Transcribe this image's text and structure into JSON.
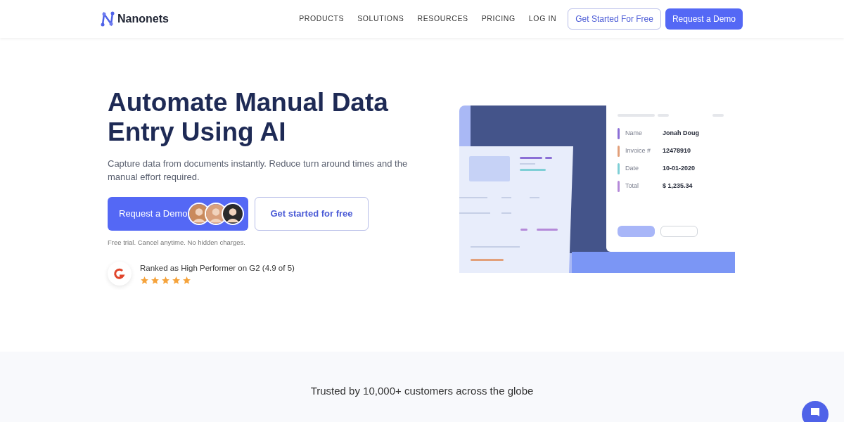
{
  "nav": {
    "brand": "Nanonets",
    "links": [
      "PRODUCTS",
      "SOLUTIONS",
      "RESOURCES",
      "PRICING",
      "LOG IN"
    ],
    "secondary_button": "Get Started For Free",
    "primary_button": "Request a Demo"
  },
  "hero": {
    "title": "Automate Manual Data Entry Using AI",
    "subtitle": "Capture data from documents instantly. Reduce turn around times and the manual effort required.",
    "demo_button": "Request a Demo",
    "free_button": "Get started for free",
    "note": "Free trial. Cancel anytime. No hidden charges.",
    "rating": {
      "text": "Ranked as High Performer on G2 (4.9 of 5)",
      "stars": 5
    }
  },
  "illustration": {
    "fields": [
      {
        "label": "Name",
        "value": "Jonah Doug",
        "color": "#8b6fd6"
      },
      {
        "label": "Invoice #",
        "value": "12478910",
        "color": "#e2a07a"
      },
      {
        "label": "Date",
        "value": "10-01-2020",
        "color": "#7fcfd6"
      },
      {
        "label": "Total",
        "value": "$ 1,235.34",
        "color": "#b58ad9"
      }
    ]
  },
  "trusted": {
    "text": "Trusted by 10,000+ customers across the globe"
  }
}
